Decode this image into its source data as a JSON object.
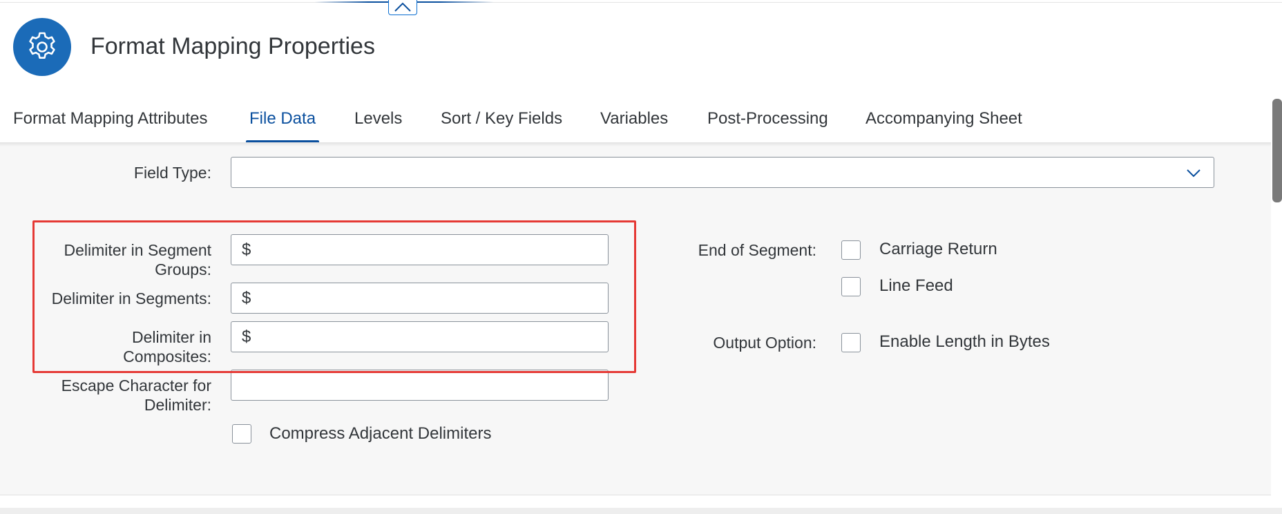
{
  "header": {
    "title": "Format Mapping Properties",
    "icon": "gear-icon",
    "icon_bg": "#1b6bb8"
  },
  "tabs": [
    {
      "label": "Format Mapping Attributes",
      "active": false
    },
    {
      "label": "File Data",
      "active": true
    },
    {
      "label": "Levels",
      "active": false
    },
    {
      "label": "Sort / Key Fields",
      "active": false
    },
    {
      "label": "Variables",
      "active": false
    },
    {
      "label": "Post-Processing",
      "active": false
    },
    {
      "label": "Accompanying Sheet",
      "active": false
    }
  ],
  "form": {
    "field_type": {
      "label": "Field Type:",
      "value": ""
    },
    "delim_segment_groups": {
      "label_line1": "Delimiter in Segment",
      "label_line2": "Groups:",
      "value": "$"
    },
    "delim_segments": {
      "label": "Delimiter in Segments:",
      "value": "$"
    },
    "delim_composites": {
      "label_line1": "Delimiter in",
      "label_line2": "Composites:",
      "value": "$"
    },
    "escape_char": {
      "label_line1": "Escape Character for",
      "label_line2": "Delimiter:",
      "value": ""
    },
    "compress_adjacent": {
      "label": "Compress Adjacent Delimiters",
      "checked": false
    },
    "end_of_segment": {
      "label": "End of Segment:",
      "carriage_return": {
        "label": "Carriage Return",
        "checked": false
      },
      "line_feed": {
        "label": "Line Feed",
        "checked": false
      }
    },
    "output_option": {
      "label": "Output Option:",
      "enable_length_bytes": {
        "label": "Enable Length in Bytes",
        "checked": false
      }
    }
  },
  "colors": {
    "accent": "#0a4f9e",
    "highlight": "#e53935",
    "content_bg": "#f7f7f7"
  }
}
